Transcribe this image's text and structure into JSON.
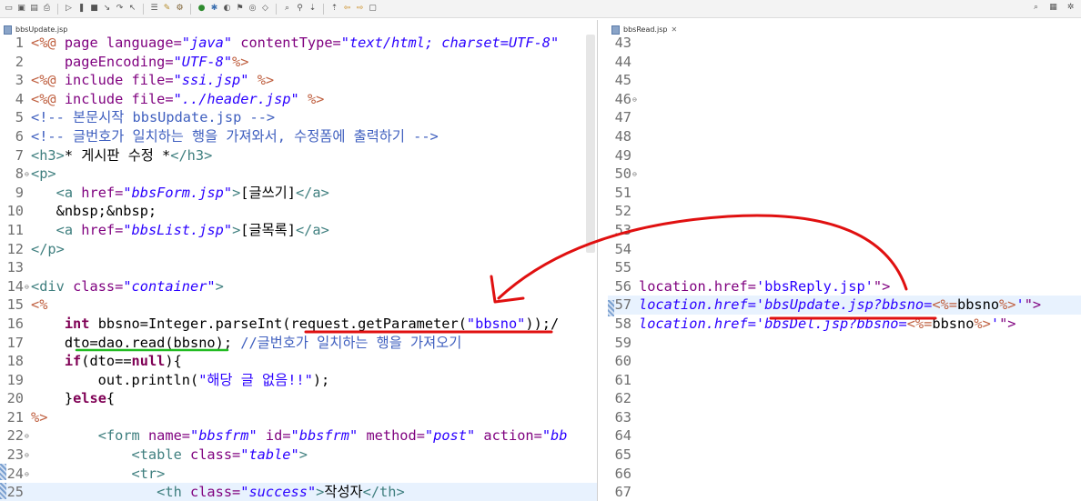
{
  "toolbar": {
    "icons": [
      "new-file-icon",
      "save-icon",
      "save-all-icon",
      "print-icon",
      "resume-icon",
      "suspend-icon",
      "terminate-icon",
      "step-into-icon",
      "step-over-icon",
      "step-return-icon",
      "task-icon",
      "tool-icon",
      "gear-icon",
      "run-icon",
      "debug-icon",
      "profile-icon",
      "external-tools-icon",
      "new-class-icon",
      "open-type-icon",
      "search-icon",
      "pin-icon",
      "next-annotation-icon",
      "prev-annotation-icon",
      "back-icon",
      "forward-icon",
      "maximize-icon"
    ],
    "right_icons": [
      "search-icon",
      "perspective-java-ee-icon",
      "perspective-debug-icon"
    ]
  },
  "left_editor": {
    "tab_label": "bbsUpdate.jsp",
    "lines": [
      {
        "n": "1",
        "fold": "",
        "segs": [
          [
            "pi",
            "<%@ "
          ],
          [
            "att",
            "page language="
          ],
          [
            "val",
            "\"java\" "
          ],
          [
            "att",
            "contentType="
          ],
          [
            "val",
            "\"text/html; charset=UTF-8\""
          ]
        ]
      },
      {
        "n": "2",
        "fold": "",
        "segs": [
          [
            "txt",
            "    "
          ],
          [
            "att",
            "pageEncoding="
          ],
          [
            "val",
            "\"UTF-8\""
          ],
          [
            "pi",
            "%>"
          ]
        ]
      },
      {
        "n": "3",
        "fold": "",
        "segs": [
          [
            "pi",
            "<%@ "
          ],
          [
            "att",
            "include "
          ],
          [
            "att",
            "file="
          ],
          [
            "val",
            "\"ssi.jsp\" "
          ],
          [
            "pi",
            "%>"
          ]
        ]
      },
      {
        "n": "4",
        "fold": "",
        "segs": [
          [
            "pi",
            "<%@ "
          ],
          [
            "att",
            "include "
          ],
          [
            "att",
            "file="
          ],
          [
            "val",
            "\"../header.jsp\" "
          ],
          [
            "pi",
            "%>"
          ]
        ]
      },
      {
        "n": "5",
        "fold": "",
        "segs": [
          [
            "cmt",
            "<!-- 본문시작 bbsUpdate.jsp -->"
          ]
        ]
      },
      {
        "n": "6",
        "fold": "",
        "segs": [
          [
            "cmt",
            "<!-- 글번호가 일치하는 행을 가져와서, 수정폼에 출력하기 -->"
          ]
        ]
      },
      {
        "n": "7",
        "fold": "",
        "segs": [
          [
            "tag",
            "<h3>"
          ],
          [
            "txt",
            "* 게시판 수정 *"
          ],
          [
            "tag",
            "</h3>"
          ]
        ]
      },
      {
        "n": "8",
        "fold": "⊖",
        "segs": [
          [
            "tag",
            "<p>"
          ]
        ]
      },
      {
        "n": "9",
        "fold": "",
        "segs": [
          [
            "txt",
            "   "
          ],
          [
            "tag",
            "<a "
          ],
          [
            "att",
            "href="
          ],
          [
            "val",
            "\"bbsForm.jsp\""
          ],
          [
            "tag",
            ">"
          ],
          [
            "txt",
            "[글쓰기]"
          ],
          [
            "tag",
            "</a>"
          ]
        ]
      },
      {
        "n": "10",
        "fold": "",
        "segs": [
          [
            "txt",
            "   &nbsp;&nbsp;"
          ]
        ]
      },
      {
        "n": "11",
        "fold": "",
        "segs": [
          [
            "txt",
            "   "
          ],
          [
            "tag",
            "<a "
          ],
          [
            "att",
            "href="
          ],
          [
            "val",
            "\"bbsList.jsp\""
          ],
          [
            "tag",
            ">"
          ],
          [
            "txt",
            "[글목록]"
          ],
          [
            "tag",
            "</a>"
          ]
        ]
      },
      {
        "n": "12",
        "fold": "",
        "segs": [
          [
            "tag",
            "</p>"
          ]
        ]
      },
      {
        "n": "13",
        "fold": "",
        "segs": []
      },
      {
        "n": "14",
        "fold": "⊖",
        "segs": [
          [
            "tag",
            "<div "
          ],
          [
            "att",
            "class="
          ],
          [
            "val",
            "\"container\""
          ],
          [
            "tag",
            ">"
          ]
        ]
      },
      {
        "n": "15",
        "fold": "",
        "segs": [
          [
            "pi",
            "<%"
          ]
        ]
      },
      {
        "n": "16",
        "fold": "",
        "segs": [
          [
            "txt",
            "    "
          ],
          [
            "kw",
            "int "
          ],
          [
            "txt",
            "bbsno=Integer.parseInt(request.getParameter("
          ],
          [
            "str",
            "\"bbsno\""
          ],
          [
            "txt",
            "));/"
          ]
        ]
      },
      {
        "n": "17",
        "fold": "",
        "segs": [
          [
            "txt",
            "    dto=dao.read(bbsno); "
          ],
          [
            "cmt",
            "//글번호가 일치하는 행을 가져오기"
          ]
        ]
      },
      {
        "n": "18",
        "fold": "",
        "segs": [
          [
            "txt",
            "    "
          ],
          [
            "kw",
            "if"
          ],
          [
            "txt",
            "(dto=="
          ],
          [
            "kw",
            "null"
          ],
          [
            "txt",
            "){"
          ]
        ]
      },
      {
        "n": "19",
        "fold": "",
        "segs": [
          [
            "txt",
            "        out.println("
          ],
          [
            "str",
            "\"해당 글 없음!!\""
          ],
          [
            "txt",
            ");"
          ]
        ]
      },
      {
        "n": "20",
        "fold": "",
        "segs": [
          [
            "txt",
            "    }"
          ],
          [
            "kw",
            "else"
          ],
          [
            "txt",
            "{"
          ]
        ]
      },
      {
        "n": "21",
        "fold": "",
        "segs": [
          [
            "pi",
            "%>"
          ]
        ]
      },
      {
        "n": "22",
        "fold": "⊖",
        "segs": [
          [
            "txt",
            "        "
          ],
          [
            "tag",
            "<form "
          ],
          [
            "att",
            "name="
          ],
          [
            "val",
            "\"bbsfrm\" "
          ],
          [
            "att",
            "id="
          ],
          [
            "val",
            "\"bbsfrm\" "
          ],
          [
            "att",
            "method="
          ],
          [
            "val",
            "\"post\" "
          ],
          [
            "att",
            "action="
          ],
          [
            "val",
            "\"bb"
          ]
        ]
      },
      {
        "n": "23",
        "fold": "⊖",
        "segs": [
          [
            "txt",
            "            "
          ],
          [
            "tag",
            "<table "
          ],
          [
            "att",
            "class="
          ],
          [
            "val",
            "\"table\""
          ],
          [
            "tag",
            ">"
          ]
        ]
      },
      {
        "n": "24",
        "fold": "⊖",
        "segs": [
          [
            "txt",
            "            "
          ],
          [
            "tag",
            "<tr>"
          ]
        ]
      },
      {
        "n": "25",
        "fold": "",
        "hl": true,
        "segs": [
          [
            "txt",
            "               "
          ],
          [
            "tag",
            "<th "
          ],
          [
            "att",
            "class="
          ],
          [
            "val",
            "\"success\""
          ],
          [
            "tag",
            ">"
          ],
          [
            "txt",
            "작성자"
          ],
          [
            "tag",
            "</th>"
          ]
        ]
      }
    ]
  },
  "right_editor": {
    "tab_label": "bbsRead.jsp",
    "lines": [
      {
        "n": "43",
        "fold": "",
        "segs": []
      },
      {
        "n": "44",
        "fold": "",
        "segs": []
      },
      {
        "n": "45",
        "fold": "",
        "segs": []
      },
      {
        "n": "46",
        "fold": "⊖",
        "segs": []
      },
      {
        "n": "47",
        "fold": "",
        "segs": []
      },
      {
        "n": "48",
        "fold": "",
        "segs": []
      },
      {
        "n": "49",
        "fold": "",
        "segs": []
      },
      {
        "n": "50",
        "fold": "⊖",
        "segs": []
      },
      {
        "n": "51",
        "fold": "",
        "segs": []
      },
      {
        "n": "52",
        "fold": "",
        "segs": []
      },
      {
        "n": "53",
        "fold": "",
        "segs": []
      },
      {
        "n": "54",
        "fold": "",
        "segs": []
      },
      {
        "n": "55",
        "fold": "",
        "segs": []
      },
      {
        "n": "56",
        "fold": "",
        "segs": [
          [
            "att",
            "location.href="
          ],
          [
            "str",
            "'bbsReply.jsp'"
          ],
          [
            "att",
            "\">"
          ]
        ]
      },
      {
        "n": "57",
        "fold": "",
        "hl": true,
        "segs": [
          [
            "val",
            "location.href='bbsUpdate.jsp?bbsno="
          ],
          [
            "pi",
            "<%="
          ],
          [
            "txt",
            "bbsno"
          ],
          [
            "pi",
            "%>"
          ],
          [
            "val",
            "'"
          ],
          [
            "att",
            "\">"
          ]
        ]
      },
      {
        "n": "58",
        "fold": "",
        "segs": [
          [
            "val",
            "location.href='bbsDel.jsp?bbsno="
          ],
          [
            "pi",
            "<%="
          ],
          [
            "txt",
            "bbsno"
          ],
          [
            "pi",
            "%>"
          ],
          [
            "val",
            "'"
          ],
          [
            "att",
            "\">"
          ]
        ]
      },
      {
        "n": "59",
        "fold": "",
        "segs": []
      },
      {
        "n": "60",
        "fold": "",
        "segs": []
      },
      {
        "n": "61",
        "fold": "",
        "segs": []
      },
      {
        "n": "62",
        "fold": "",
        "segs": []
      },
      {
        "n": "63",
        "fold": "",
        "segs": []
      },
      {
        "n": "64",
        "fold": "",
        "segs": []
      },
      {
        "n": "65",
        "fold": "",
        "segs": []
      },
      {
        "n": "66",
        "fold": "",
        "segs": []
      },
      {
        "n": "67",
        "fold": "",
        "segs": []
      }
    ]
  },
  "annotation": {
    "color": "#e01010",
    "green_color": "#22bb22"
  }
}
